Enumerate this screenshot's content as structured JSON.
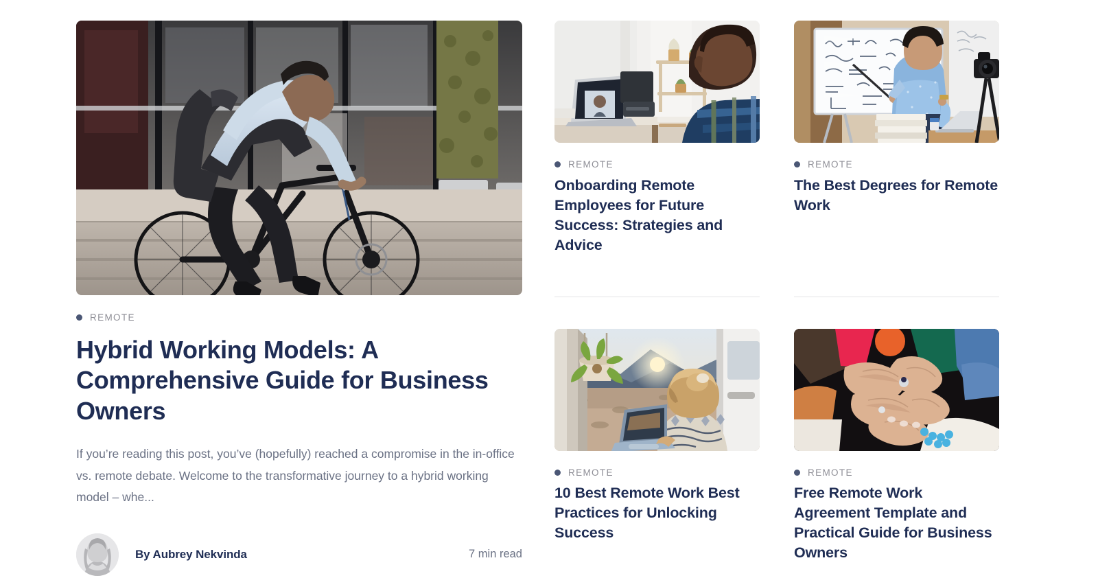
{
  "theme": {
    "title_color": "#1f2d54",
    "body_text_color": "#6a7184",
    "category_label_color": "#8e8e96",
    "category_dot_color": "#4b5775",
    "divider_color": "#e2e2e4",
    "background": "#ffffff"
  },
  "featured": {
    "category": "REMOTE",
    "title": "Hybrid Working Models: A Comprehensive Guide for Business Owners",
    "excerpt": "If you’re reading this post, you’ve (hopefully) reached a compromise in the in-office vs. remote debate. Welcome to the transformative journey to a hybrid working model – whe...",
    "author": "By Aubrey Nekvinda",
    "read_time": "7 min read",
    "image_alt": "Man with a backpack riding a black bicycle in front of a glass office building with concrete steps"
  },
  "cards": [
    {
      "category": "REMOTE",
      "title": "Onboarding Remote Employees for Future Success: Strategies and Advice",
      "image_alt": "Man in plaid shirt on a video call with a laptop at a home desk"
    },
    {
      "category": "REMOTE",
      "title": "The Best Degrees for Remote Work",
      "image_alt": "Man in blue shirt pointing at equations on a whiteboard while being filmed by a camera on a tripod"
    },
    {
      "category": "REMOTE",
      "title": "10 Best Remote Work Best Practices for Unlocking Success",
      "image_alt": "Woman working on a laptop inside a camper van overlooking mountains at sunset"
    },
    {
      "category": "REMOTE",
      "title": "Free Remote Work Agreement Template and Practical Guide for Business Owners",
      "image_alt": "Group of people in colorful knit sweaters stacking their hands together"
    }
  ]
}
